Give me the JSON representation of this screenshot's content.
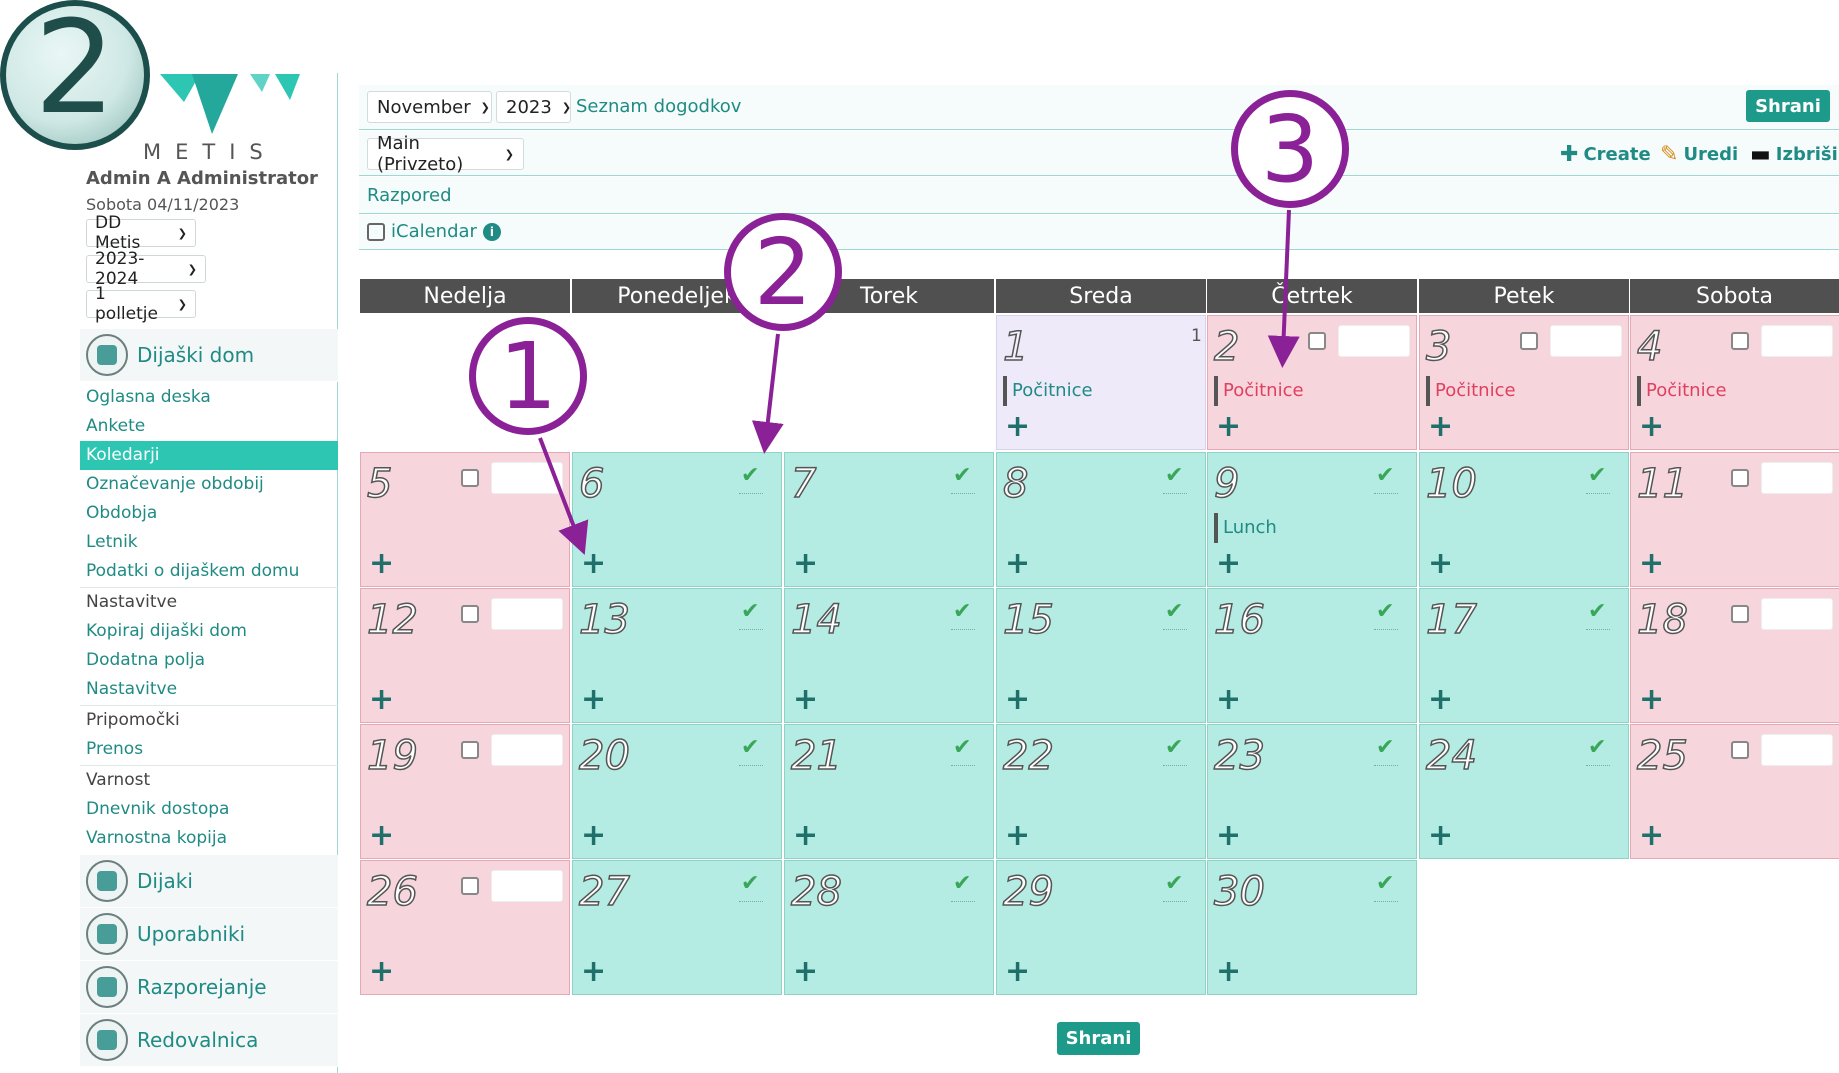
{
  "sidebar": {
    "step_badge": "2",
    "brand": "METIS",
    "user_name": "Admin A Administrator",
    "date": "Sobota 04/11/2023",
    "selects": [
      "DD Metis",
      "2023-2024",
      "1 polletje"
    ],
    "section_dijaski_dom": "Dijaški dom",
    "menu": [
      {
        "label": "Oglasna deska"
      },
      {
        "label": "Ankete"
      },
      {
        "label": "Koledarji"
      },
      {
        "label": "Označevanje obdobij"
      },
      {
        "label": "Obdobja"
      },
      {
        "label": "Letnik"
      },
      {
        "label": "Podatki o dijaškem domu"
      },
      {
        "label": "Nastavitve"
      },
      {
        "label": "Kopiraj dijaški dom"
      },
      {
        "label": "Dodatna polja"
      },
      {
        "label": "Nastavitve"
      },
      {
        "label": "Pripomočki"
      },
      {
        "label": "Prenos"
      },
      {
        "label": "Varnost"
      },
      {
        "label": "Dnevnik dostopa"
      },
      {
        "label": "Varnostna kopija"
      }
    ],
    "sections": [
      {
        "label": "Dijaki"
      },
      {
        "label": "Uporabniki"
      },
      {
        "label": "Razporejanje"
      },
      {
        "label": "Redovalnica"
      }
    ]
  },
  "toolbar": {
    "month": "November",
    "year": "2023",
    "events_link": "Seznam dogodkov",
    "save_label": "Shrani",
    "calendar_select": "Main (Privzeto)",
    "create_label": "Create",
    "edit_label": "Uredi",
    "delete_label": "Izbriši",
    "schedule_label": "Razpored",
    "icalendar_label": "iCalendar",
    "info_glyph": "i"
  },
  "calendar": {
    "weekdays": [
      "Nedelja",
      "Ponedeljek",
      "Torek",
      "Sreda",
      "Četrtek",
      "Petek",
      "Sobota"
    ],
    "days": [
      {
        "day": "1",
        "count": "1",
        "event": "Počitnice"
      },
      {
        "day": "2",
        "event": "Počitnice"
      },
      {
        "day": "3",
        "event": "Počitnice"
      },
      {
        "day": "4",
        "event": "Počitnice"
      },
      {
        "day": "5"
      },
      {
        "day": "6"
      },
      {
        "day": "7"
      },
      {
        "day": "8"
      },
      {
        "day": "9",
        "event": "Lunch"
      },
      {
        "day": "10"
      },
      {
        "day": "11"
      },
      {
        "day": "12"
      },
      {
        "day": "13"
      },
      {
        "day": "14"
      },
      {
        "day": "15"
      },
      {
        "day": "16"
      },
      {
        "day": "17"
      },
      {
        "day": "18"
      },
      {
        "day": "19"
      },
      {
        "day": "20"
      },
      {
        "day": "21"
      },
      {
        "day": "22"
      },
      {
        "day": "23"
      },
      {
        "day": "24"
      },
      {
        "day": "25"
      },
      {
        "day": "26"
      },
      {
        "day": "27"
      },
      {
        "day": "28"
      },
      {
        "day": "29"
      },
      {
        "day": "30"
      }
    ],
    "plus_glyph": "+",
    "check_glyph": "✔",
    "bottom_save": "Shrani"
  },
  "annotations": [
    "1",
    "2",
    "3"
  ],
  "colors": {
    "accent": "#1f8b84",
    "active_menu": "#2cc6b2",
    "workday": "#b4ece3",
    "weekend": "#f7d5dc",
    "holiday_weekday": "#eeeafa",
    "header": "#505050",
    "annotation": "#8b2196"
  }
}
